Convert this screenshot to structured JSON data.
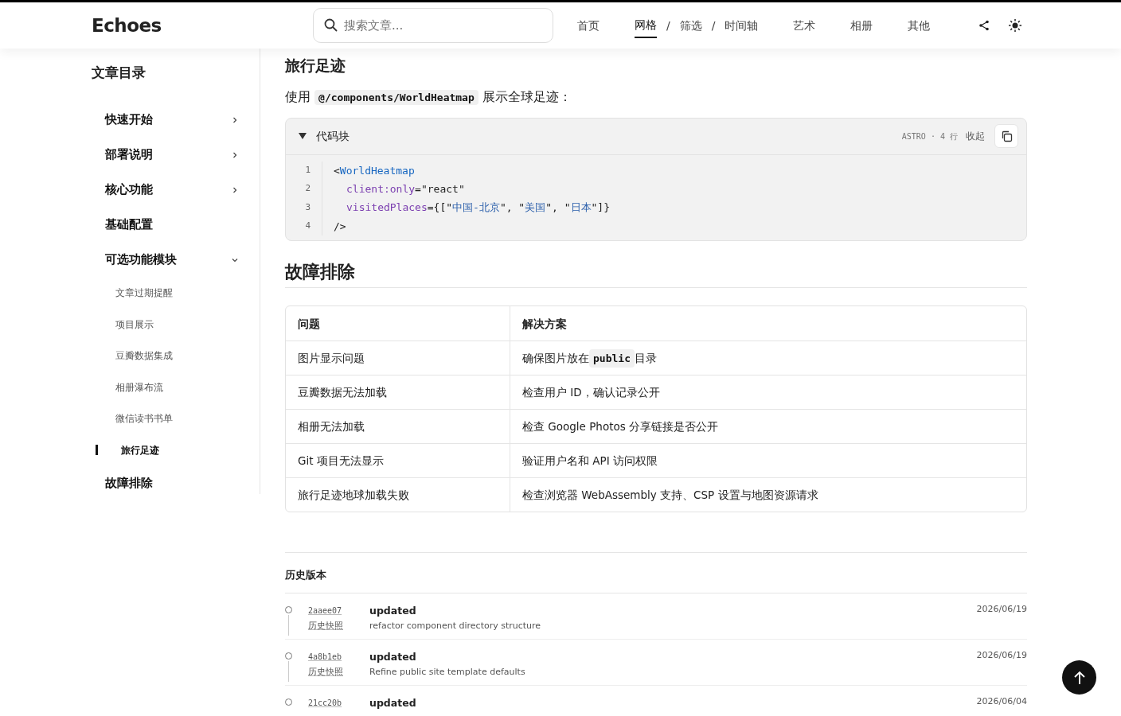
{
  "header": {
    "brand": "Echoes",
    "search": {
      "placeholder": "搜索文章..."
    },
    "nav": [
      {
        "kind": "link",
        "label": "首页",
        "selected": false
      },
      {
        "kind": "link",
        "label": "网格",
        "selected": true
      },
      {
        "kind": "separator",
        "label": "/"
      },
      {
        "kind": "link",
        "label": "筛选",
        "selected": false
      },
      {
        "kind": "separator",
        "label": "/"
      },
      {
        "kind": "link",
        "label": "时间轴",
        "selected": false
      },
      {
        "kind": "link",
        "label": "艺术",
        "selected": false
      },
      {
        "kind": "link",
        "label": "相册",
        "selected": false
      },
      {
        "kind": "link",
        "label": "其他",
        "selected": false
      }
    ]
  },
  "toc": {
    "title": "文章目录",
    "items": [
      {
        "kind": "group",
        "label": "快速开始",
        "expanded": false
      },
      {
        "kind": "group",
        "label": "部署说明",
        "expanded": false
      },
      {
        "kind": "group",
        "label": "核心功能",
        "expanded": false
      },
      {
        "kind": "leaf",
        "label": "基础配置"
      },
      {
        "kind": "group",
        "label": "可选功能模块",
        "expanded": true,
        "children": [
          {
            "label": "文章过期提醒",
            "selected": false
          },
          {
            "label": "项目展示",
            "selected": false
          },
          {
            "label": "豆瓣数据集成",
            "selected": false
          },
          {
            "label": "相册瀑布流",
            "selected": false
          },
          {
            "label": "微信读书书单",
            "selected": false
          },
          {
            "label": "旅行足迹",
            "selected": true
          }
        ]
      },
      {
        "kind": "leaf",
        "label": "故障排除"
      }
    ]
  },
  "article": {
    "section_heading": "旅行足迹",
    "intro": [
      {
        "kind": "text",
        "text": "使用 "
      },
      {
        "kind": "code",
        "text": "@/components/WorldHeatmap"
      },
      {
        "kind": "text",
        "text": " 展示全球足迹："
      }
    ],
    "code_block": {
      "title": "代码块",
      "expanded": true,
      "meta": "ASTRO · 4 行",
      "collapse_label": "收起",
      "lines": [
        {
          "number": "1",
          "tokens": [
            {
              "kind": "punct",
              "text": "<"
            },
            {
              "kind": "tag",
              "text": "WorldHeatmap"
            }
          ]
        },
        {
          "number": "2",
          "indented": true,
          "tokens": [
            {
              "kind": "attr",
              "text": "client:only"
            },
            {
              "kind": "punct",
              "text": "="
            },
            {
              "kind": "string",
              "text": "\"react\""
            }
          ]
        },
        {
          "number": "3",
          "indented": true,
          "tokens": [
            {
              "kind": "attr",
              "text": "visitedPlaces"
            },
            {
              "kind": "punct",
              "text": "={[\""
            },
            {
              "kind": "value",
              "text": "中国-北京"
            },
            {
              "kind": "punct",
              "text": "\", \""
            },
            {
              "kind": "value",
              "text": "美国"
            },
            {
              "kind": "punct",
              "text": "\", \""
            },
            {
              "kind": "value",
              "text": "日本"
            },
            {
              "kind": "punct",
              "text": "\"]}"
            }
          ]
        },
        {
          "number": "4",
          "tokens": [
            {
              "kind": "punct",
              "text": "/>"
            }
          ]
        }
      ]
    },
    "heading": "故障排除",
    "table": {
      "columns": [
        "问题",
        "解决方案"
      ],
      "rows": [
        [
          [
            {
              "kind": "text",
              "text": "图片显示问题"
            }
          ],
          [
            {
              "kind": "text",
              "text": "确保图片放在 "
            },
            {
              "kind": "code",
              "text": "public"
            },
            {
              "kind": "text",
              "text": " 目录"
            }
          ]
        ],
        [
          [
            {
              "kind": "text",
              "text": "豆瓣数据无法加载"
            }
          ],
          [
            {
              "kind": "text",
              "text": "检查用户 ID，确认记录公开"
            }
          ]
        ],
        [
          [
            {
              "kind": "text",
              "text": "相册无法加载"
            }
          ],
          [
            {
              "kind": "text",
              "text": "检查 Google Photos 分享链接是否公开"
            }
          ]
        ],
        [
          [
            {
              "kind": "text",
              "text": "Git 项目无法显示"
            }
          ],
          [
            {
              "kind": "text",
              "text": "验证用户名和 API 访问权限"
            }
          ]
        ],
        [
          [
            {
              "kind": "text",
              "text": "旅行足迹地球加载失败"
            }
          ],
          [
            {
              "kind": "text",
              "text": "检查浏览器 WebAssembly 支持、CSP 设置与地图资源请求"
            }
          ]
        ]
      ]
    },
    "history": {
      "title": "历史版本",
      "entries": [
        {
          "hash": "2aaee07",
          "snapshot": "历史快照",
          "title": "updated",
          "message": "refactor component directory structure",
          "date": "2026/06/19"
        },
        {
          "hash": "4a8b1eb",
          "snapshot": "历史快照",
          "title": "updated",
          "message": "Refine public site template defaults",
          "date": "2026/06/19"
        },
        {
          "hash": "21cc20b",
          "title": "updated",
          "date": "2026/06/04"
        }
      ]
    }
  }
}
